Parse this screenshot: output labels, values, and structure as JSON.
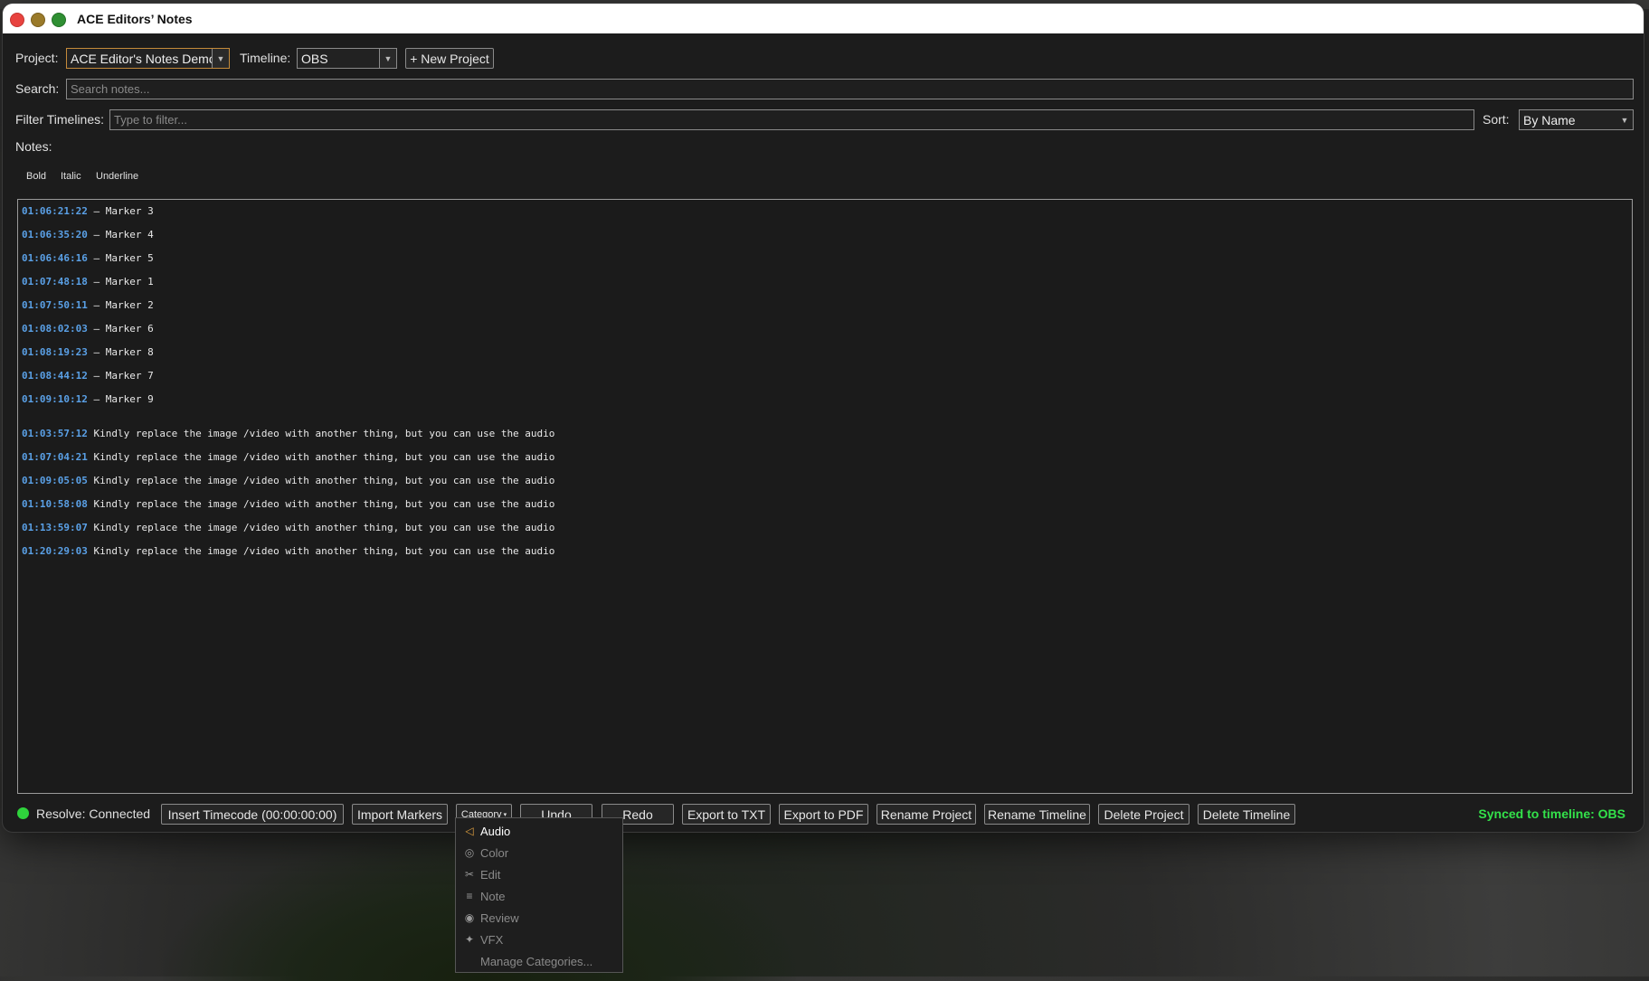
{
  "window": {
    "title": "ACE Editors’ Notes"
  },
  "project": {
    "label": "Project:",
    "value": "ACE Editor's Notes Demo"
  },
  "timeline": {
    "label": "Timeline:",
    "value": "OBS"
  },
  "new_project_label": "+ New Project",
  "search": {
    "label": "Search:",
    "placeholder": "Search notes..."
  },
  "filter": {
    "label": "Filter Timelines:",
    "placeholder": "Type to filter..."
  },
  "sort": {
    "label": "Sort:",
    "value": "By Name"
  },
  "notes_label": "Notes:",
  "format": {
    "bold": "Bold",
    "italic": "Italic",
    "underline": "Underline"
  },
  "markers": [
    {
      "tc": "01:06:21:22",
      "text": " — Marker 3"
    },
    {
      "tc": "01:06:35:20",
      "text": " — Marker 4"
    },
    {
      "tc": "01:06:46:16",
      "text": " — Marker 5"
    },
    {
      "tc": "01:07:48:18",
      "text": " — Marker 1"
    },
    {
      "tc": "01:07:50:11",
      "text": " — Marker 2"
    },
    {
      "tc": "01:08:02:03",
      "text": " — Marker 6"
    },
    {
      "tc": "01:08:19:23",
      "text": " — Marker 8"
    },
    {
      "tc": "01:08:44:12",
      "text": " — Marker 7"
    },
    {
      "tc": "01:09:10:12",
      "text": " — Marker 9"
    }
  ],
  "comments": [
    {
      "tc": "01:03:57:12",
      "text": " Kindly replace the image /video with another thing, but you can use the audio"
    },
    {
      "tc": "01:07:04:21",
      "text": " Kindly replace the image /video with another thing, but you can use the audio"
    },
    {
      "tc": "01:09:05:05",
      "text": " Kindly replace the image /video with another thing, but you can use the audio"
    },
    {
      "tc": "01:10:58:08",
      "text": " Kindly replace the image /video with another thing, but you can use the audio"
    },
    {
      "tc": "01:13:59:07",
      "text": " Kindly replace the image /video with another thing, but you can use the audio"
    },
    {
      "tc": "01:20:29:03",
      "text": " Kindly replace the image /video with another thing, but you can use the audio"
    }
  ],
  "status": {
    "text": "Resolve: Connected",
    "color": "#2fd33c"
  },
  "toolbar": {
    "insert_timecode": "Insert Timecode (00:00:00:00)",
    "import_markers": "Import Markers",
    "category": "Category",
    "undo": "Undo",
    "redo": "Redo",
    "export_txt": "Export to TXT",
    "export_pdf": "Export to PDF",
    "rename_project": "Rename Project",
    "rename_timeline": "Rename Timeline",
    "delete_project": "Delete Project",
    "delete_timeline": "Delete Timeline"
  },
  "synced": "Synced to timeline: OBS",
  "category_menu": [
    {
      "label": "Audio",
      "icon": "speaker-icon"
    },
    {
      "label": "Color",
      "icon": "palette-icon"
    },
    {
      "label": "Edit",
      "icon": "scissors-icon"
    },
    {
      "label": "Note",
      "icon": "lines-icon"
    },
    {
      "label": "Review",
      "icon": "eye-icon"
    },
    {
      "label": "VFX",
      "icon": "sparkle-icon"
    },
    {
      "label": "Manage Categories...",
      "icon": ""
    }
  ]
}
